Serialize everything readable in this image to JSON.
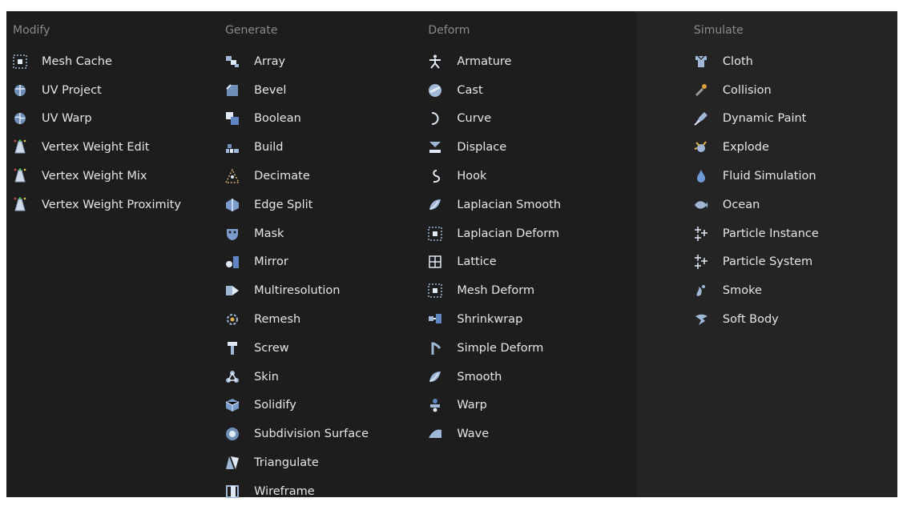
{
  "columns": [
    {
      "title": "Modify",
      "items": [
        {
          "label": "Mesh Cache",
          "icon": "mesh-cache-icon"
        },
        {
          "label": "UV Project",
          "icon": "uv-project-icon"
        },
        {
          "label": "UV Warp",
          "icon": "uv-warp-icon"
        },
        {
          "label": "Vertex Weight Edit",
          "icon": "vertex-weight-icon"
        },
        {
          "label": "Vertex Weight Mix",
          "icon": "vertex-weight-icon"
        },
        {
          "label": "Vertex Weight Proximity",
          "icon": "vertex-weight-icon"
        }
      ]
    },
    {
      "title": "Generate",
      "items": [
        {
          "label": "Array",
          "icon": "array-icon"
        },
        {
          "label": "Bevel",
          "icon": "bevel-icon"
        },
        {
          "label": "Boolean",
          "icon": "boolean-icon"
        },
        {
          "label": "Build",
          "icon": "build-icon"
        },
        {
          "label": "Decimate",
          "icon": "decimate-icon"
        },
        {
          "label": "Edge Split",
          "icon": "edge-split-icon"
        },
        {
          "label": "Mask",
          "icon": "mask-icon"
        },
        {
          "label": "Mirror",
          "icon": "mirror-icon"
        },
        {
          "label": "Multiresolution",
          "icon": "multiresolution-icon"
        },
        {
          "label": "Remesh",
          "icon": "remesh-icon"
        },
        {
          "label": "Screw",
          "icon": "screw-icon"
        },
        {
          "label": "Skin",
          "icon": "skin-icon"
        },
        {
          "label": "Solidify",
          "icon": "solidify-icon"
        },
        {
          "label": "Subdivision Surface",
          "icon": "subdivision-surface-icon"
        },
        {
          "label": "Triangulate",
          "icon": "triangulate-icon"
        },
        {
          "label": "Wireframe",
          "icon": "wireframe-icon"
        }
      ]
    },
    {
      "title": "Deform",
      "items": [
        {
          "label": "Armature",
          "icon": "armature-icon"
        },
        {
          "label": "Cast",
          "icon": "cast-icon"
        },
        {
          "label": "Curve",
          "icon": "curve-icon"
        },
        {
          "label": "Displace",
          "icon": "displace-icon"
        },
        {
          "label": "Hook",
          "icon": "hook-icon"
        },
        {
          "label": "Laplacian Smooth",
          "icon": "smooth-icon"
        },
        {
          "label": "Laplacian Deform",
          "icon": "mesh-deform-icon"
        },
        {
          "label": "Lattice",
          "icon": "lattice-icon"
        },
        {
          "label": "Mesh Deform",
          "icon": "mesh-deform-icon"
        },
        {
          "label": "Shrinkwrap",
          "icon": "shrinkwrap-icon"
        },
        {
          "label": "Simple Deform",
          "icon": "simple-deform-icon"
        },
        {
          "label": "Smooth",
          "icon": "smooth-icon"
        },
        {
          "label": "Warp",
          "icon": "warp-icon"
        },
        {
          "label": "Wave",
          "icon": "wave-icon"
        }
      ]
    },
    {
      "title": "Simulate",
      "items": [
        {
          "label": "Cloth",
          "icon": "cloth-icon"
        },
        {
          "label": "Collision",
          "icon": "collision-icon"
        },
        {
          "label": "Dynamic Paint",
          "icon": "dynamic-paint-icon"
        },
        {
          "label": "Explode",
          "icon": "explode-icon"
        },
        {
          "label": "Fluid Simulation",
          "icon": "fluid-icon"
        },
        {
          "label": "Ocean",
          "icon": "ocean-icon"
        },
        {
          "label": "Particle Instance",
          "icon": "particles-icon"
        },
        {
          "label": "Particle System",
          "icon": "particles-icon"
        },
        {
          "label": "Smoke",
          "icon": "smoke-icon"
        },
        {
          "label": "Soft Body",
          "icon": "soft-body-icon"
        }
      ]
    }
  ]
}
